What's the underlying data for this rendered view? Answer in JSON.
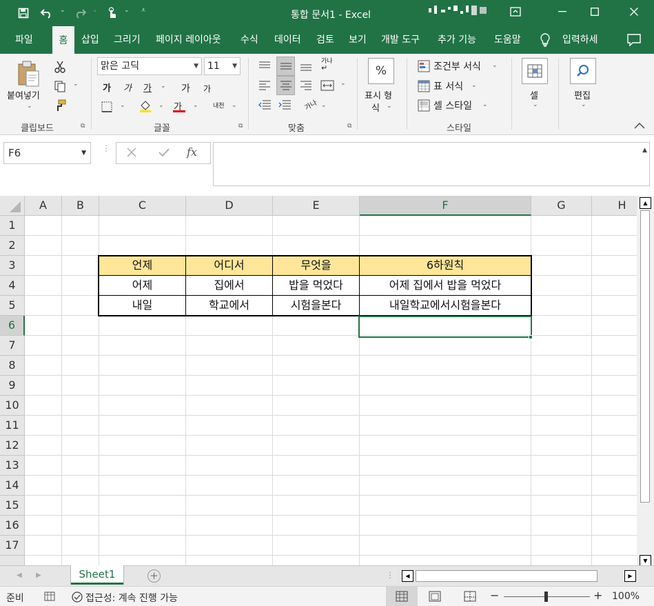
{
  "window": {
    "title": "통합 문서1 - Excel",
    "accent_color": "#217346"
  },
  "quick_access": {
    "save_icon": "save-icon",
    "undo_icon": "undo-icon",
    "redo_icon": "redo-icon",
    "touch_icon": "touch-mode-icon"
  },
  "tabs": [
    "파일",
    "홈",
    "삽입",
    "그리기",
    "페이지 레이아웃",
    "수식",
    "데이터",
    "검토",
    "보기",
    "개발 도구",
    "추가 기능",
    "도움말",
    "입력하세"
  ],
  "active_tab": "홈",
  "ribbon": {
    "clipboard": {
      "paste_label": "붙여넣기",
      "group_label": "클립보드"
    },
    "font": {
      "font_name": "맑은 고딕",
      "font_size": "11",
      "bold": "가",
      "italic": "가",
      "underline": "가",
      "grow": "가",
      "shrink": "가",
      "font_color": "가",
      "phonetic": "내천",
      "group_label": "글꼴"
    },
    "alignment": {
      "wrap_label": "가나",
      "orient_label": "가나",
      "group_label": "맞춤"
    },
    "number": {
      "percent": "%",
      "format_label_1": "표시 형",
      "format_label_2": "식"
    },
    "styles": {
      "conditional": "조건부 서식",
      "table_format": "표 서식",
      "cell_style": "셀 스타일",
      "group_label": "스타일"
    },
    "cells": {
      "label": "셀"
    },
    "editing": {
      "label": "편집"
    }
  },
  "formula_bar": {
    "name_box": "F6",
    "formula_value": "",
    "fx_label": "fx"
  },
  "columns": [
    "A",
    "B",
    "C",
    "D",
    "E",
    "F",
    "G",
    "H"
  ],
  "rows": [
    "1",
    "2",
    "3",
    "4",
    "5",
    "6",
    "7",
    "8",
    "9",
    "10",
    "11",
    "12",
    "13",
    "14",
    "15",
    "16",
    "17"
  ],
  "selected_cell": "F6",
  "table": {
    "headers": [
      "언제",
      "어디서",
      "무엇을",
      "6하원칙"
    ],
    "rows": [
      [
        "어제",
        "집에서",
        "밥을 먹었다",
        "어제 집에서 밥을 먹었다"
      ],
      [
        "내일",
        "학교에서",
        "시험을본다",
        "내일학교에서시험을본다"
      ]
    ],
    "header_fill": "#ffe699"
  },
  "sheet_tabs": [
    "Sheet1"
  ],
  "status": {
    "mode": "준비",
    "accessibility": "접근성: 계속 진행 가능",
    "zoom": "100%"
  }
}
